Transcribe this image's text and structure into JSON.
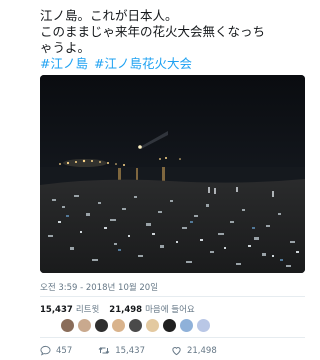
{
  "tweet": {
    "lines": [
      "江ノ島。これが日本人。",
      "このままじゃ来年の花火大会無くなっち",
      "ゃうよ。"
    ],
    "hashtags": [
      "#江ノ島",
      "#江ノ島花火大会"
    ],
    "timestamp": "오전 3:59 - 2018년 10월 20일"
  },
  "stats": {
    "retweets_count": "15,437",
    "retweets_label": "리트윗",
    "likes_count": "21,498",
    "likes_label": "마음에 들어요"
  },
  "likers": [
    {
      "name": "liker-avatar-1",
      "color": "#8a6d5a"
    },
    {
      "name": "liker-avatar-2",
      "color": "#c9a98e"
    },
    {
      "name": "liker-avatar-3",
      "color": "#2f2f2f"
    },
    {
      "name": "liker-avatar-4",
      "color": "#d9b38c"
    },
    {
      "name": "liker-avatar-5",
      "color": "#4a4a4a"
    },
    {
      "name": "liker-avatar-6",
      "color": "#e3c9a0"
    },
    {
      "name": "liker-avatar-7",
      "color": "#1f1f1f"
    },
    {
      "name": "liker-avatar-8",
      "color": "#8fb1d9"
    },
    {
      "name": "liker-avatar-9",
      "color": "#b9c7e6"
    }
  ],
  "actions": {
    "reply_count": "457",
    "retweet_count": "15,437",
    "like_count": "21,498"
  },
  "colors": {
    "link": "#1da1f2",
    "secondary_text": "#657786",
    "primary_text": "#14171a"
  }
}
